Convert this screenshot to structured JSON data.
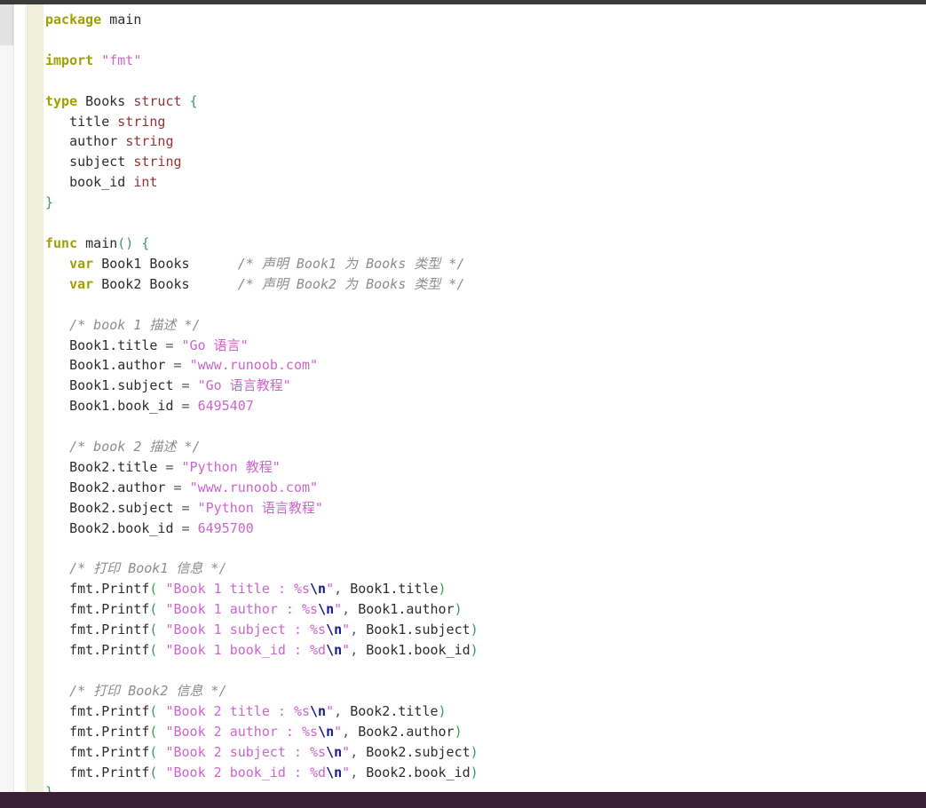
{
  "editor": {
    "language": "go",
    "background": "#ffffff",
    "gutter_color": "#eff0d9",
    "top_chrome_color": "#3b3b3b",
    "bottom_chrome_color": "#3b1f34",
    "scrollbar": {
      "orientation": "vertical",
      "thumb_color": "#e2e2e2",
      "track_color": "#f6f6f6"
    },
    "colors": {
      "keyword": "#a0a000",
      "type": "#993333",
      "string": "#cc66cc",
      "escape": "#1a1a8c",
      "number": "#cc66cc",
      "punctuation": "#3c9a5f",
      "comment": "#8d8d8d",
      "identifier": "#2e2e2e"
    }
  },
  "code": {
    "l01": {
      "kw": "package",
      "ident": "main"
    },
    "l02": "",
    "l03": {
      "kw": "import",
      "str": "\"fmt\""
    },
    "l04": "",
    "l05": {
      "kw": "type",
      "ident": "Books",
      "typ": "struct",
      "punc": "{"
    },
    "l06": {
      "field": "title",
      "typ": "string"
    },
    "l07": {
      "field": "author",
      "typ": "string"
    },
    "l08": {
      "field": "subject",
      "typ": "string"
    },
    "l09": {
      "field": "book_id",
      "typ": "int"
    },
    "l10": {
      "punc": "}"
    },
    "l11": "",
    "l12": {
      "kw": "func",
      "ident": "main",
      "punc_open": "()",
      "punc_brace": "{"
    },
    "l13": {
      "kw": "var",
      "ident": "Book1 Books",
      "cmt": "/* 声明 Book1 为 Books 类型 */"
    },
    "l14": {
      "kw": "var",
      "ident": "Book2 Books",
      "cmt": "/* 声明 Book2 为 Books 类型 */"
    },
    "l15": "",
    "l16": {
      "cmt": "/* book 1 描述 */"
    },
    "l17": {
      "lhs": "Book1.title",
      "op": "=",
      "str": "\"Go 语言\""
    },
    "l18": {
      "lhs": "Book1.author",
      "op": "=",
      "str": "\"www.runoob.com\""
    },
    "l19": {
      "lhs": "Book1.subject",
      "op": "=",
      "str": "\"Go 语言教程\""
    },
    "l20": {
      "lhs": "Book1.book_id",
      "op": "=",
      "num": "6495407"
    },
    "l21": "",
    "l22": {
      "cmt": "/* book 2 描述 */"
    },
    "l23": {
      "lhs": "Book2.title",
      "op": "=",
      "str": "\"Python 教程\""
    },
    "l24": {
      "lhs": "Book2.author",
      "op": "=",
      "str": "\"www.runoob.com\""
    },
    "l25": {
      "lhs": "Book2.subject",
      "op": "=",
      "str": "\"Python 语言教程\""
    },
    "l26": {
      "lhs": "Book2.book_id",
      "op": "=",
      "num": "6495700"
    },
    "l27": "",
    "l28": {
      "cmt": "/* 打印 Book1 信息 */"
    },
    "l29": {
      "call": "fmt.Printf",
      "str_a": "\"Book 1 title : %s",
      "esc": "\\n",
      "str_b": "\"",
      "arg": "Book1.title"
    },
    "l30": {
      "call": "fmt.Printf",
      "str_a": "\"Book 1 author : %s",
      "esc": "\\n",
      "str_b": "\"",
      "arg": "Book1.author"
    },
    "l31": {
      "call": "fmt.Printf",
      "str_a": "\"Book 1 subject : %s",
      "esc": "\\n",
      "str_b": "\"",
      "arg": "Book1.subject"
    },
    "l32": {
      "call": "fmt.Printf",
      "str_a": "\"Book 1 book_id : %d",
      "esc": "\\n",
      "str_b": "\"",
      "arg": "Book1.book_id"
    },
    "l33": "",
    "l34": {
      "cmt": "/* 打印 Book2 信息 */"
    },
    "l35": {
      "call": "fmt.Printf",
      "str_a": "\"Book 2 title : %s",
      "esc": "\\n",
      "str_b": "\"",
      "arg": "Book2.title"
    },
    "l36": {
      "call": "fmt.Printf",
      "str_a": "\"Book 2 author : %s",
      "esc": "\\n",
      "str_b": "\"",
      "arg": "Book2.author"
    },
    "l37": {
      "call": "fmt.Printf",
      "str_a": "\"Book 2 subject : %s",
      "esc": "\\n",
      "str_b": "\"",
      "arg": "Book2.subject"
    },
    "l38": {
      "call": "fmt.Printf",
      "str_a": "\"Book 2 book_id : %d",
      "esc": "\\n",
      "str_b": "\"",
      "arg": "Book2.book_id"
    },
    "l39": {
      "punc": "}"
    }
  },
  "symbols": {
    "paren_open": "(",
    "paren_close": ")",
    "paren_pair": "()",
    "brace_open": "{",
    "brace_close": "}",
    "equals": "=",
    "comma": ",",
    "space": " "
  }
}
